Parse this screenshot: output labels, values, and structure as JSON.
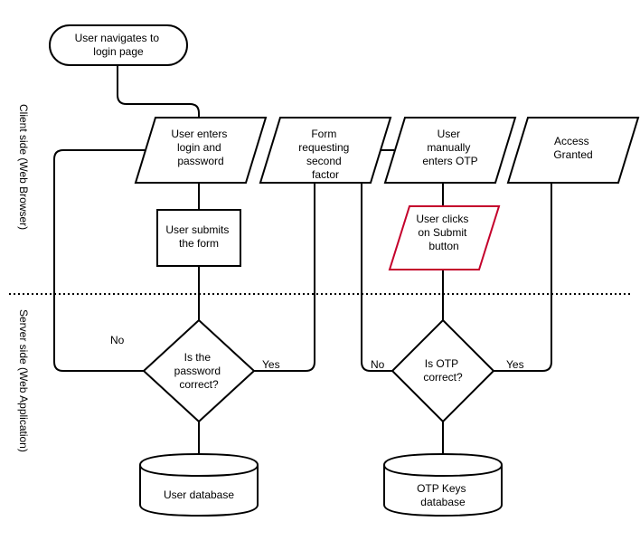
{
  "swimlanes": {
    "client": "Client side (Web Browser)",
    "server": "Server side (Web Application)"
  },
  "nodes": {
    "start": "User navigates to login page",
    "enterLogin": "User enters login and password",
    "formSecond": "Form requesting second factor",
    "enterOtp": "User manually enters OTP",
    "accessGranted": "Access Granted",
    "submitForm": "User submits the form",
    "clickSubmit": "User clicks on Submit button",
    "pwdCorrect": "Is the password correct?",
    "otpCorrect": "Is OTP correct?",
    "userDb": "User database",
    "otpDb": "OTP Keys database"
  },
  "edges": {
    "yes1": "Yes",
    "no1": "No",
    "yes2": "Yes",
    "no2": "No"
  }
}
